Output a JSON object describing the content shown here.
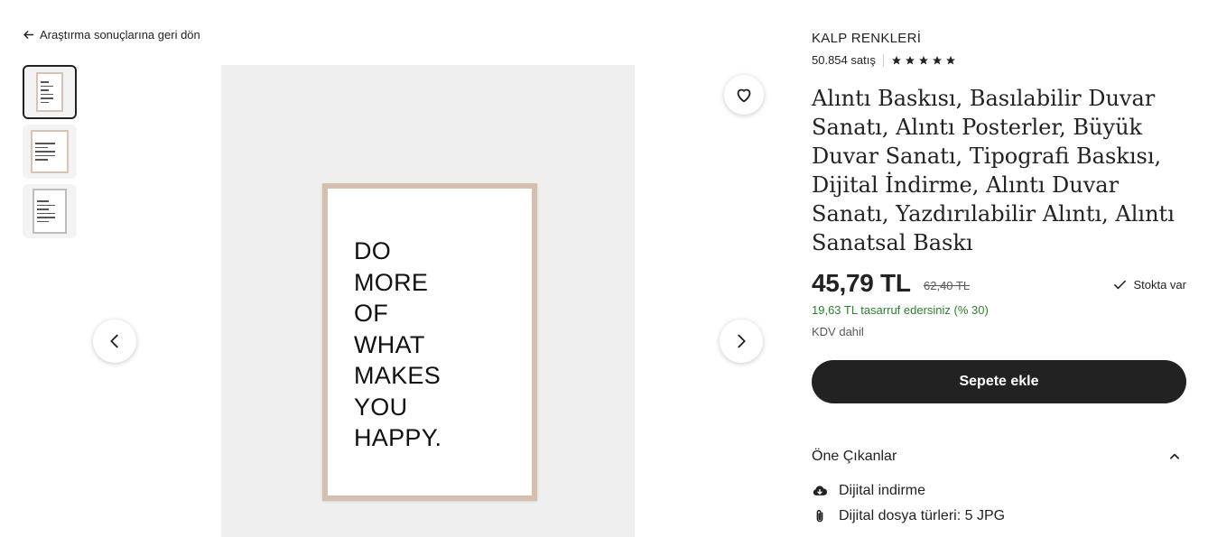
{
  "nav": {
    "back_label": "Araştırma sonuçlarına geri dön"
  },
  "gallery": {
    "thumbnails": [
      "thumb-1",
      "thumb-2",
      "thumb-3"
    ],
    "poster_lines": [
      "DO",
      "MORE",
      "OF",
      "WHAT",
      "MAKES",
      "YOU",
      "HAPPY."
    ]
  },
  "shop": {
    "name": "KALP RENKLERİ",
    "sales": "50.854 satış",
    "rating_stars": 5
  },
  "product": {
    "title": "Alıntı Baskısı, Basılabilir Duvar Sanatı, Alıntı Posterler, Büyük Duvar Sanatı, Tipografi Baskısı, Dijital İndirme, Alıntı Duvar Sanatı, Yazdırılabilir Alıntı, Alıntı Sanatsal Baskı",
    "price": "45,79 TL",
    "old_price": "62,40 TL",
    "stock": "Stokta var",
    "savings": "19,63 TL tasarruf edersiniz (% 30)",
    "vat": "KDV dahil",
    "cart_button": "Sepete ekle"
  },
  "highlights": {
    "heading": "Öne Çıkanlar",
    "items": [
      {
        "icon": "cloud-download-icon",
        "label": "Dijital indirme"
      },
      {
        "icon": "paperclip-icon",
        "label": "Dijital dosya türleri: 5 JPG"
      }
    ]
  },
  "colors": {
    "accent": "#222222",
    "savings": "#2e7d32",
    "frame": "#d6bfae"
  }
}
